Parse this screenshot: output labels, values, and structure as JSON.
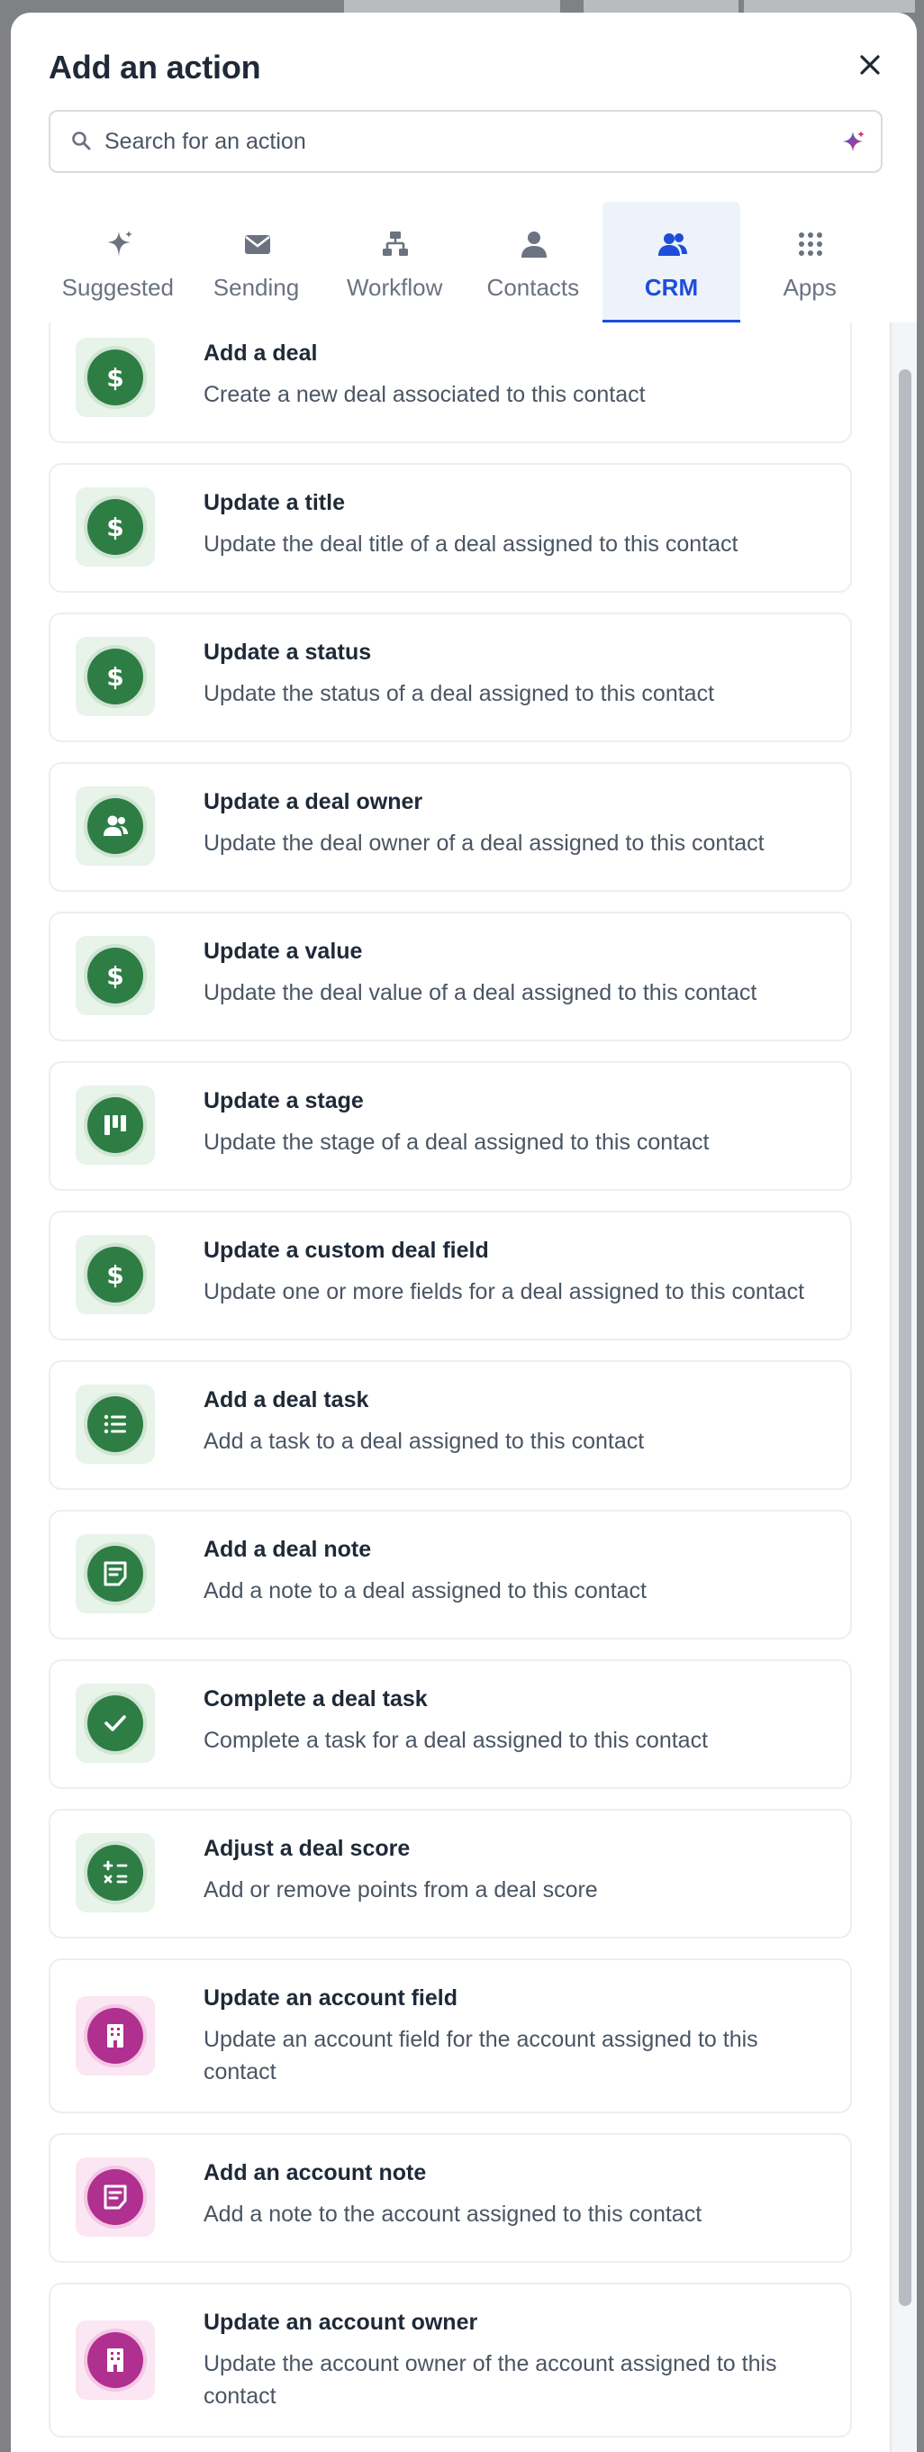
{
  "modal": {
    "title": "Add an action",
    "close_label": "Close"
  },
  "search": {
    "placeholder": "Search for an action",
    "value": ""
  },
  "tabs": [
    {
      "label": "Suggested",
      "icon": "sparkle-icon",
      "active": false
    },
    {
      "label": "Sending",
      "icon": "envelope-icon",
      "active": false
    },
    {
      "label": "Workflow",
      "icon": "workflow-icon",
      "active": false
    },
    {
      "label": "Contacts",
      "icon": "person-icon",
      "active": false
    },
    {
      "label": "CRM",
      "icon": "people-icon",
      "active": true
    },
    {
      "label": "Apps",
      "icon": "grid-icon",
      "active": false
    }
  ],
  "actions": [
    {
      "title": "Add a deal",
      "description": "Create a new deal associated to this contact",
      "icon": "dollar-icon",
      "color": "green"
    },
    {
      "title": "Update a title",
      "description": "Update the deal title of a deal assigned to this contact",
      "icon": "dollar-icon",
      "color": "green"
    },
    {
      "title": "Update a status",
      "description": "Update the status of a deal assigned to this contact",
      "icon": "dollar-icon",
      "color": "green"
    },
    {
      "title": "Update a deal owner",
      "description": "Update the deal owner of a deal assigned to this contact",
      "icon": "people-icon",
      "color": "green"
    },
    {
      "title": "Update a value",
      "description": "Update the deal value of a deal assigned to this contact",
      "icon": "dollar-icon",
      "color": "green"
    },
    {
      "title": "Update a stage",
      "description": "Update the stage of a deal assigned to this contact",
      "icon": "pipeline-icon",
      "color": "green"
    },
    {
      "title": "Update a custom deal field",
      "description": "Update one or more fields for a deal assigned to this contact",
      "icon": "dollar-icon",
      "color": "green"
    },
    {
      "title": "Add a deal task",
      "description": "Add a task to a deal assigned to this contact",
      "icon": "list-icon",
      "color": "green"
    },
    {
      "title": "Add a deal note",
      "description": "Add a note to a deal assigned to this contact",
      "icon": "note-icon",
      "color": "green"
    },
    {
      "title": "Complete a deal task",
      "description": "Complete a task for a deal assigned to this contact",
      "icon": "checkmark-icon",
      "color": "green"
    },
    {
      "title": "Adjust a deal score",
      "description": "Add or remove points from a deal score",
      "icon": "calculator-icon",
      "color": "green"
    },
    {
      "title": "Update an account field",
      "description": "Update an account field for the account assigned to this contact",
      "icon": "building-icon",
      "color": "purple"
    },
    {
      "title": "Add an account note",
      "description": "Add a note to the account assigned to this contact",
      "icon": "note-icon",
      "color": "purple"
    },
    {
      "title": "Update an account owner",
      "description": "Update the account owner of the account assigned to this contact",
      "icon": "building-icon",
      "color": "purple"
    }
  ],
  "colors": {
    "accent": "#1d4ed8",
    "deal_green": "#2e7d45",
    "account_purple": "#b0308f"
  }
}
